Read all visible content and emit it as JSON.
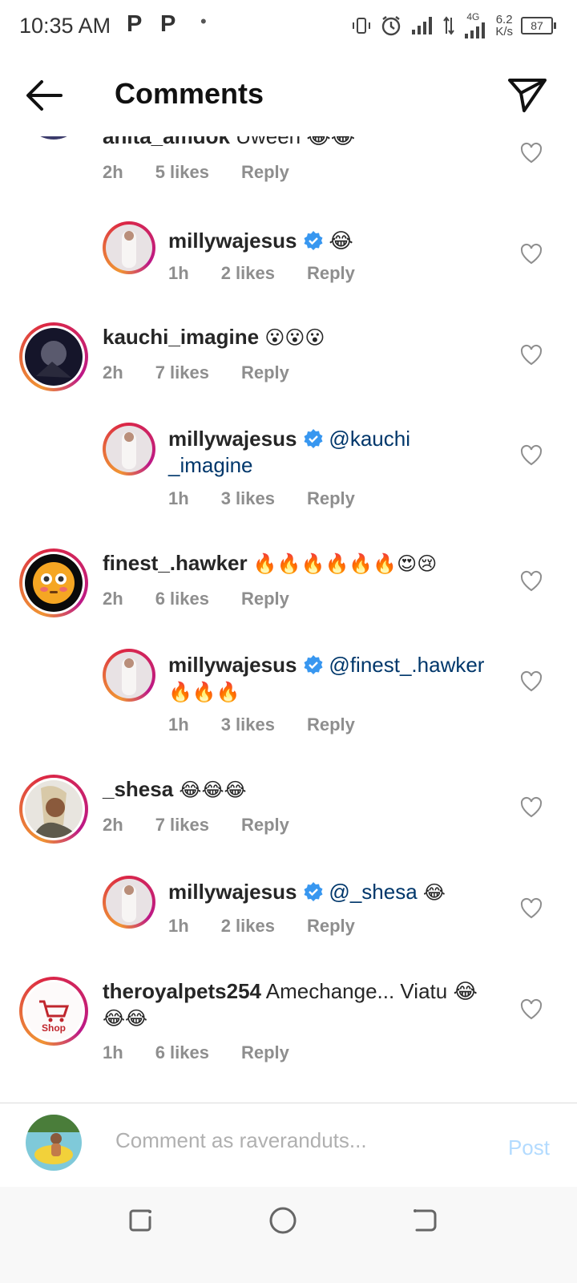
{
  "status_bar": {
    "time": "10:35 AM",
    "p1": "P",
    "p2": "P",
    "dot": "•",
    "net_type": "4G",
    "speed_top": "6.2",
    "speed_bottom": "K/s",
    "battery": "87"
  },
  "header": {
    "title": "Comments"
  },
  "comments": [
    {
      "user": "anita_amdok",
      "text": "Uween 😂😂",
      "time": "2h",
      "likes": "5 likes",
      "reply": "Reply"
    },
    {
      "user": "millywajesus",
      "text": "😂",
      "time": "1h",
      "likes": "2 likes",
      "reply": "Reply"
    },
    {
      "user": "kauchi_imagine",
      "text": "😮😮😮",
      "time": "2h",
      "likes": "7 likes",
      "reply": "Reply"
    },
    {
      "user": "millywajesus",
      "mention": "@kauchi",
      "mention2": "_imagine",
      "time": "1h",
      "likes": "3 likes",
      "reply": "Reply"
    },
    {
      "user": "finest_.hawker",
      "text": "🔥🔥🔥🔥🔥🔥😍😢",
      "time": "2h",
      "likes": "6 likes",
      "reply": "Reply"
    },
    {
      "user": "millywajesus",
      "mention": "@finest_.hawker",
      "text": "🔥🔥🔥",
      "time": "1h",
      "likes": "3 likes",
      "reply": "Reply"
    },
    {
      "user": "_shesa",
      "text": "😂😂😂",
      "time": "2h",
      "likes": "7 likes",
      "reply": "Reply"
    },
    {
      "user": "millywajesus",
      "mention": "@_shesa",
      "text": "😂",
      "time": "1h",
      "likes": "2 likes",
      "reply": "Reply"
    },
    {
      "user": "theroyalpets254",
      "text": "Amechange... Viatu 😂",
      "text2": "😂😂",
      "time": "1h",
      "likes": "6 likes",
      "reply": "Reply"
    }
  ],
  "royalpets_logo": "Shop",
  "composer": {
    "placeholder": "Comment as raveranduts...",
    "post_label": "Post"
  },
  "colors": {
    "mention": "#00376b",
    "post_disabled": "#b3dbff",
    "meta_gray": "#8e8e8e",
    "verified": "#3897f0"
  }
}
